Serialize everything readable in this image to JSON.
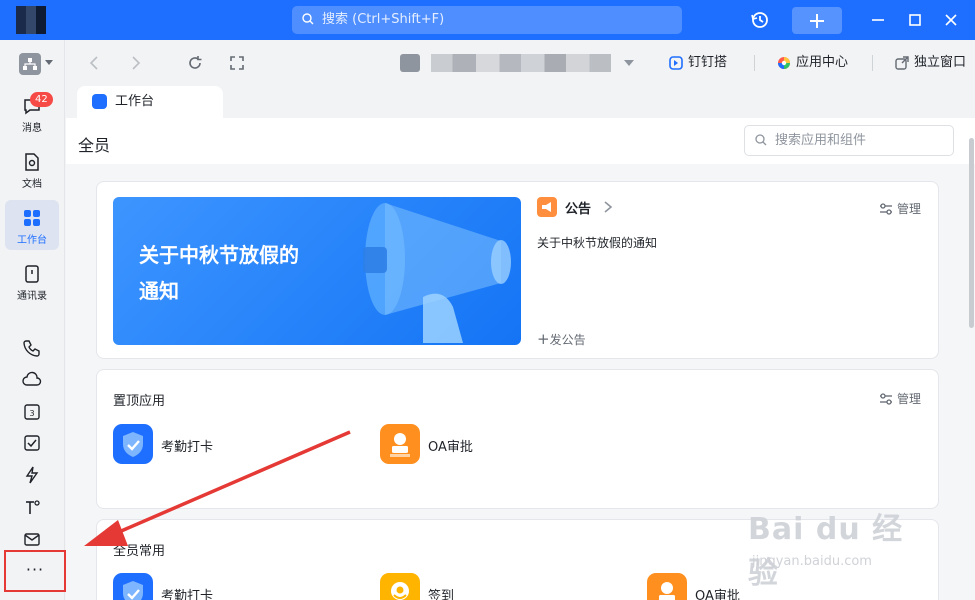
{
  "titlebar": {
    "search_placeholder": "搜索 (Ctrl+Shift+F)",
    "brand_color": "#1e6fff"
  },
  "rail": {
    "badge_count": "42",
    "items": [
      {
        "label": "消息",
        "icon": "chat-bubble-icon"
      },
      {
        "label": "文档",
        "icon": "document-icon"
      },
      {
        "label": "工作台",
        "icon": "grid-icon",
        "active": true
      },
      {
        "label": "通讯录",
        "icon": "contacts-icon"
      }
    ],
    "extra_icons": [
      "phone-icon",
      "cloud-icon",
      "calendar-icon",
      "checkbox-icon",
      "lightning-icon",
      "tool-icon",
      "mail-icon"
    ],
    "more_label": "···"
  },
  "navbar": {
    "links": [
      "钉钉搭",
      "应用中心",
      "独立窗口"
    ]
  },
  "tab": {
    "label": "工作台"
  },
  "main": {
    "title": "全员",
    "search_placeholder": "搜索应用和组件",
    "announcement": {
      "banner_text_1": "关于中秋节放假的",
      "banner_text_2": "通知",
      "title": "公告",
      "item": "关于中秋节放假的通知",
      "post_label": "发公告",
      "manage_label": "管理"
    },
    "pinned": {
      "title": "置顶应用",
      "manage_label": "管理",
      "apps": [
        {
          "label": "考勤打卡",
          "color": "#1e6fff"
        },
        {
          "label": "OA审批",
          "color": "#ff8f1f"
        }
      ]
    },
    "common": {
      "title": "全员常用",
      "apps": [
        {
          "label": "考勤打卡",
          "color": "#1e6fff"
        },
        {
          "label": "签到",
          "color": "#ffb400"
        },
        {
          "label": "OA审批",
          "color": "#ff8f1f"
        }
      ]
    }
  },
  "watermark": {
    "main": "Bai du 经验",
    "sub": "jingyan.baidu.com"
  },
  "annotation_color": "#e53935"
}
